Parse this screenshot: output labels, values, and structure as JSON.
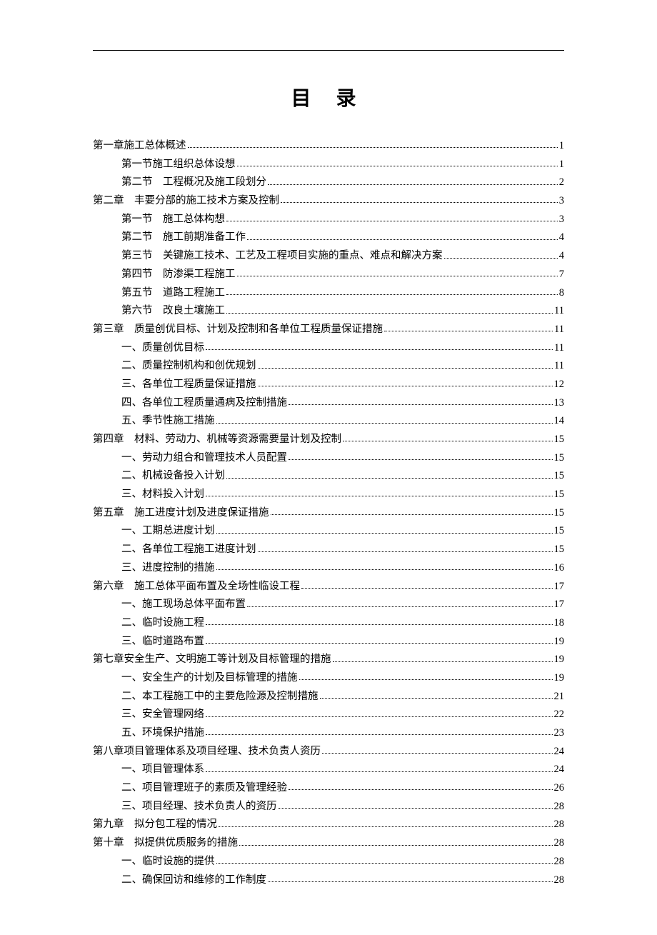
{
  "title": "目 录",
  "toc": [
    {
      "level": 1,
      "label": "第一章施工总体概述",
      "page": "1"
    },
    {
      "level": 2,
      "label": "第一节施工组织总体设想",
      "page": "1"
    },
    {
      "level": 2,
      "label": "第二节　工程概况及施工段划分",
      "page": "2"
    },
    {
      "level": 1,
      "label": "第二章　丰要分部的施工技术方案及控制",
      "page": "3"
    },
    {
      "level": 2,
      "label": "第一节　施工总体构想",
      "page": "3"
    },
    {
      "level": 2,
      "label": "第二节　施工前期准备工作",
      "page": "4"
    },
    {
      "level": 2,
      "label": "第三节　关键施工技术、工艺及工程项目实施的重点、难点和解决方案",
      "page": "4"
    },
    {
      "level": 2,
      "label": "第四节　防渗渠工程施工",
      "page": "7"
    },
    {
      "level": 2,
      "label": "第五节　道路工程施工",
      "page": "8"
    },
    {
      "level": 2,
      "label": "第六节　改良土壤施工",
      "page": "11"
    },
    {
      "level": 1,
      "label": "第三章　质量创优目标、计划及控制和各单位工程质量保证措施",
      "page": "11"
    },
    {
      "level": 2,
      "label": "一、质量创优目标",
      "page": "11"
    },
    {
      "level": 2,
      "label": "二、质量控制机构和创优规划",
      "page": "11"
    },
    {
      "level": 2,
      "label": "三、各单位工程质量保证措施",
      "page": "12"
    },
    {
      "level": 2,
      "label": "四、各单位工程质量通病及控制措施",
      "page": "13"
    },
    {
      "level": 2,
      "label": "五、季节性施工措施",
      "page": "14"
    },
    {
      "level": 1,
      "label": "第四章　材料、劳动力、机械等资源需要量计划及控制",
      "page": "15"
    },
    {
      "level": 2,
      "label": "一、劳动力组合和管理技术人员配置",
      "page": "15"
    },
    {
      "level": 2,
      "label": "二、机械设备投入计划",
      "page": "15"
    },
    {
      "level": 2,
      "label": "三、材料投入计划",
      "page": "15"
    },
    {
      "level": 1,
      "label": "第五章　施工进度计划及进度保证措施",
      "page": "15"
    },
    {
      "level": 2,
      "label": "一、工期总进度计划",
      "page": "15"
    },
    {
      "level": 2,
      "label": "二、各单位工程施工进度计划",
      "page": "15"
    },
    {
      "level": 2,
      "label": "三、进度控制的措施",
      "page": "16"
    },
    {
      "level": 1,
      "label": "第六章　施工总体平面布置及全场性临设工程",
      "page": "17"
    },
    {
      "level": 2,
      "label": "一、施工现场总体平面布置",
      "page": "17"
    },
    {
      "level": 2,
      "label": "二、临时设施工程",
      "page": "18"
    },
    {
      "level": 2,
      "label": "三、临时道路布置",
      "page": "19"
    },
    {
      "level": 1,
      "label": "第七章安全生产、文明施工等计划及目标管理的措施",
      "page": "19"
    },
    {
      "level": 2,
      "label": "一、安全生产的计划及目标管理的措施",
      "page": "19"
    },
    {
      "level": 2,
      "label": "二、本工程施工中的主要危险源及控制措施",
      "page": "21"
    },
    {
      "level": 2,
      "label": "三、安全管理网络",
      "page": "22"
    },
    {
      "level": 2,
      "label": "五、环境保护措施",
      "page": "23"
    },
    {
      "level": 1,
      "label": "第八章项目管理体系及项目经理、技术负责人资历",
      "page": "24"
    },
    {
      "level": 2,
      "label": "一、项目管理体系",
      "page": "24"
    },
    {
      "level": 2,
      "label": "二、项目管理班子的素质及管理经验",
      "page": "26"
    },
    {
      "level": 2,
      "label": "三、项目经理、技术负责人的资历",
      "page": "28"
    },
    {
      "level": 1,
      "label": "第九章　拟分包工程的情况",
      "page": "28"
    },
    {
      "level": 1,
      "label": "第十章　拟提供优质服务的措施",
      "page": "28"
    },
    {
      "level": 2,
      "label": "一、临时设施的提供",
      "page": "28"
    },
    {
      "level": 2,
      "label": "二、确保回访和维修的工作制度",
      "page": "28"
    }
  ]
}
